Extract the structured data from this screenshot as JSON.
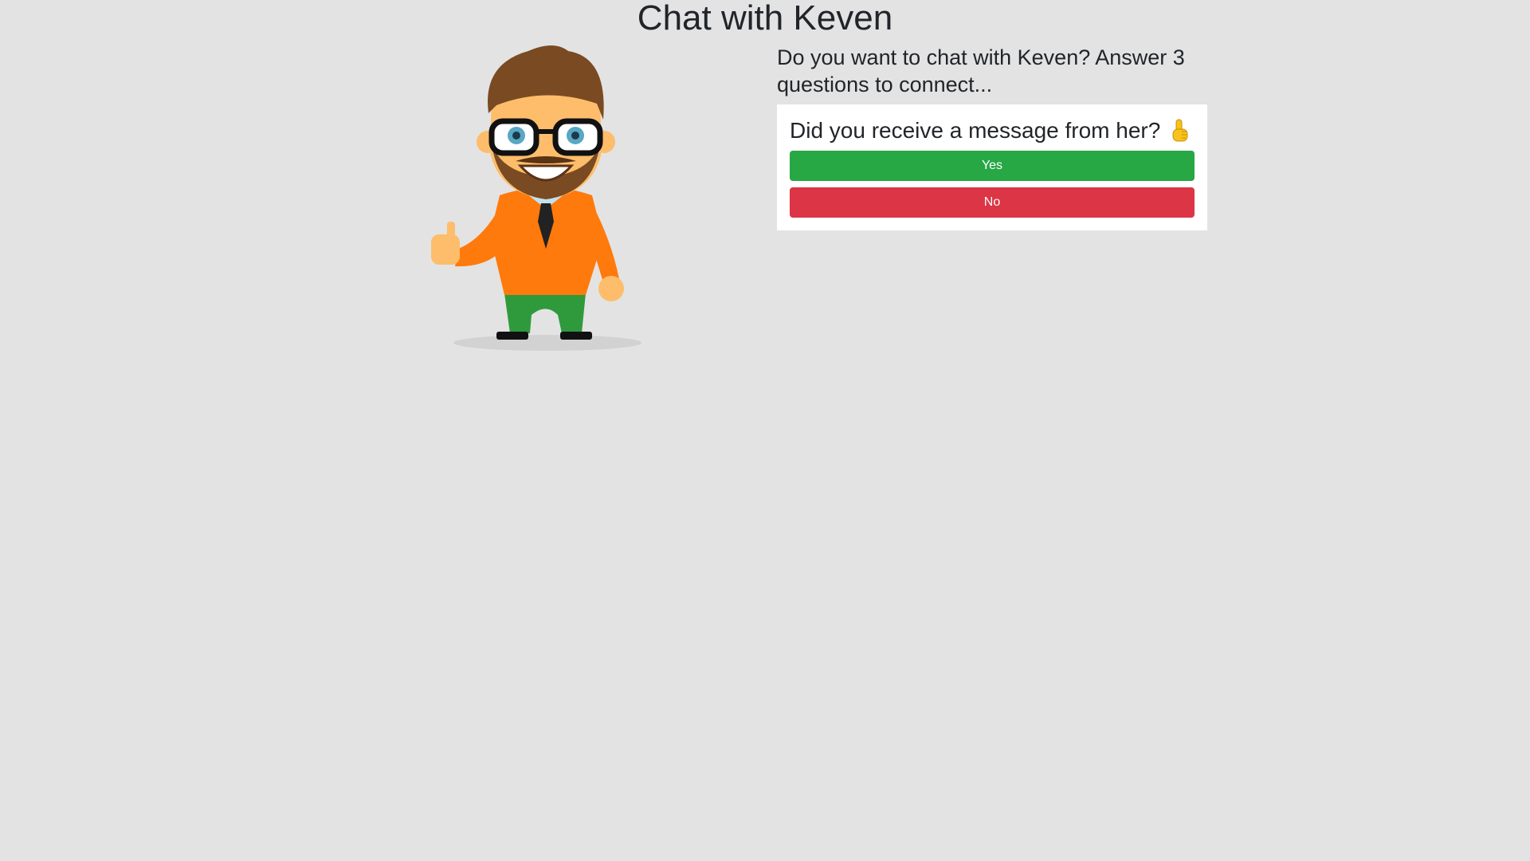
{
  "header": {
    "title": "Chat with Keven"
  },
  "intro": {
    "text": "Do you want to chat with Keven? Answer 3 questions to connect..."
  },
  "quiz": {
    "question": "Did you receive a message from her?",
    "question_icon": "pointing-up-hand-icon",
    "yes_label": "Yes",
    "no_label": "No"
  },
  "mascot": {
    "icon": "cartoon-man-thumbs-up"
  },
  "colors": {
    "background": "#e3e3e3",
    "yes": "#28a745",
    "no": "#dc3545",
    "card": "#ffffff"
  }
}
